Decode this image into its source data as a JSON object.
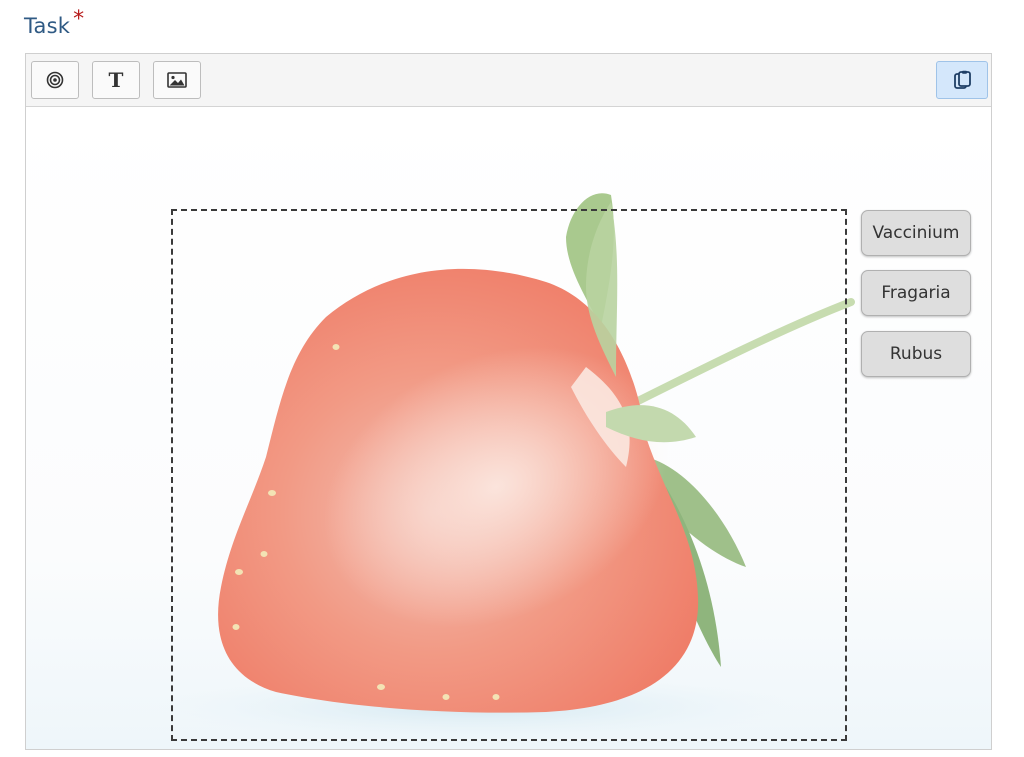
{
  "task": {
    "label": "Task",
    "required_mark": "*"
  },
  "toolbar": {
    "buttons": [
      {
        "icon": "target-icon"
      },
      {
        "icon": "text-icon",
        "glyph": "T"
      },
      {
        "icon": "image-icon"
      }
    ],
    "paste_button": {
      "icon": "clipboard-icon"
    }
  },
  "canvas": {
    "background_image": "halved strawberry",
    "choices": [
      {
        "label": "Vaccinium"
      },
      {
        "label": "Fragaria"
      },
      {
        "label": "Rubus"
      }
    ]
  },
  "colors": {
    "label": "#2f5a84",
    "required": "#b71c1c",
    "active_button": "#d4e7fb",
    "choice_bg": "#dedede"
  }
}
